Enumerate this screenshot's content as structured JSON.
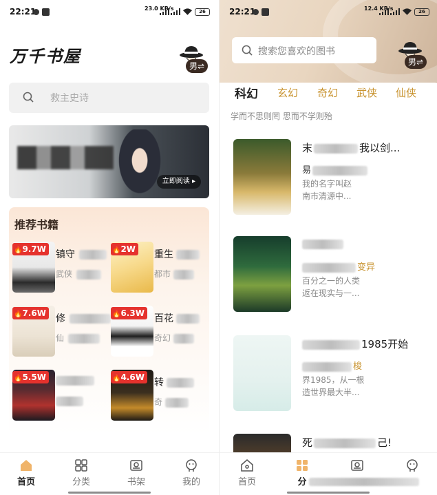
{
  "status_left": {
    "time": "22:21",
    "speed": "23.0\nKB/s"
  },
  "status_right": {
    "time": "22:21",
    "speed": "12.4\nKB/s"
  },
  "battery": "26",
  "left": {
    "logo": "万千书屋",
    "gender": "男⇌",
    "search_placeholder": "救主史诗",
    "banner": {
      "read_button": "立即阅读 ▸"
    },
    "recommend_title": "推荐书籍",
    "books": [
      {
        "count": "9.7W",
        "title": "镇守",
        "category": "武侠"
      },
      {
        "count": "2W",
        "title": "重生",
        "category": "都市"
      },
      {
        "count": "7.6W",
        "title": "修",
        "category": "仙"
      },
      {
        "count": "6.3W",
        "title": "百花",
        "category": "奇幻"
      },
      {
        "count": "5.5W",
        "title": "",
        "category": ""
      },
      {
        "count": "4.6W",
        "title": "转",
        "category": "奇"
      }
    ]
  },
  "right": {
    "gender": "男⇌",
    "search_placeholder": "搜索您喜欢的图书",
    "categories": [
      "科幻",
      "玄幻",
      "奇幻",
      "武侠",
      "仙侠"
    ],
    "motto": "学而不思则罔 思而不学则殆",
    "books": [
      {
        "title": "末",
        "title_tail": "我以剑...",
        "author": "易",
        "desc": "我的名字叫赵\n南市清源中..."
      },
      {
        "title": "",
        "title_tail": "",
        "author": "变异",
        "desc": "百分之一的人类\n返在现实与一..."
      },
      {
        "title": "",
        "title_tail": "1985开始",
        "author": "梭",
        "desc": "界1985，从一根\n造世界最大半..."
      },
      {
        "title": "死",
        "title_tail": "己!",
        "author": "",
        "desc": ""
      }
    ]
  },
  "tabs_left": [
    {
      "label": "首页",
      "icon": "home-icon",
      "active": true
    },
    {
      "label": "分类",
      "icon": "grid-icon",
      "active": false
    },
    {
      "label": "书架",
      "icon": "bookshelf-icon",
      "active": false
    },
    {
      "label": "我的",
      "icon": "profile-icon",
      "active": false
    }
  ],
  "tabs_right": [
    {
      "label": "首页",
      "icon": "home-icon",
      "active": false
    },
    {
      "label": "分",
      "icon": "grid-icon",
      "active": true
    },
    {
      "label": "",
      "icon": "bookshelf-icon",
      "active": false
    },
    {
      "label": "",
      "icon": "profile-icon",
      "active": false
    }
  ],
  "colors": {
    "accent": "#c8932f",
    "badge_red": "#e5322d",
    "home_active": "#f0b46a"
  }
}
